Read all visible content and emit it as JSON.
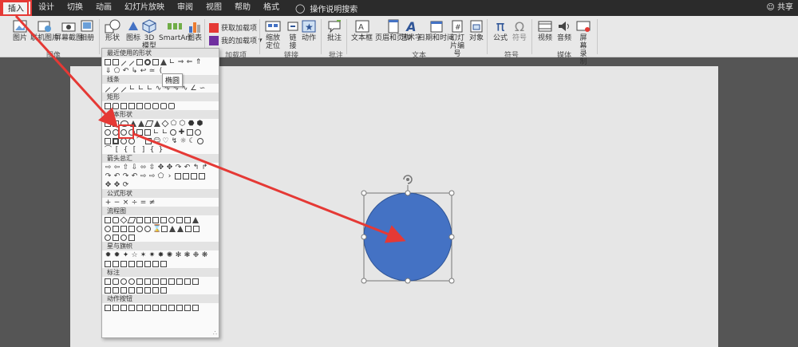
{
  "tabs": [
    "插入",
    "设计",
    "切换",
    "动画",
    "幻灯片放映",
    "审阅",
    "视图",
    "帮助",
    "格式"
  ],
  "search": {
    "label": "操作说明搜索"
  },
  "share": {
    "label": "共享"
  },
  "ribbon": {
    "image_group": {
      "label": "图像",
      "picture": "图片",
      "online_picture": "联机图片",
      "screenshot": "屏幕截图",
      "album": "相册"
    },
    "illustrations_group": {
      "shapes": "形状",
      "icons": "图标",
      "model3d": "3D 模型",
      "smartart": "SmartArt",
      "chart": "图表"
    },
    "addins_group": {
      "label": "加载项",
      "get_addins": "获取加载项",
      "my_addins": "我的加载项"
    },
    "links_group": {
      "label": "链接",
      "zoom": "缩放定位",
      "link": "链接",
      "action": "动作"
    },
    "comments_group": {
      "label": "批注",
      "comment": "批注"
    },
    "text_group": {
      "label": "文本",
      "textbox": "文本框",
      "header_footer": "页眉和页脚",
      "wordart": "艺术字",
      "datetime": "日期和时间",
      "slide_number": "幻灯片编号",
      "object": "对象"
    },
    "symbols_group": {
      "label": "符号",
      "equation": "公式",
      "symbol": "符号"
    },
    "media_group": {
      "label": "媒体",
      "video": "视频",
      "audio": "音频",
      "screen_recording": "屏幕录制"
    }
  },
  "shapes_panel": {
    "categories": [
      "最近使用的形状",
      "线条",
      "矩形",
      "基本形状",
      "箭头总汇",
      "公式形状",
      "流程图",
      "星与旗帜",
      "标注",
      "动作按钮"
    ],
    "tooltip": "椭圆"
  },
  "colors": {
    "accent_red": "#e53935",
    "circle_fill": "#4472c4",
    "circle_stroke": "#2f5597"
  }
}
